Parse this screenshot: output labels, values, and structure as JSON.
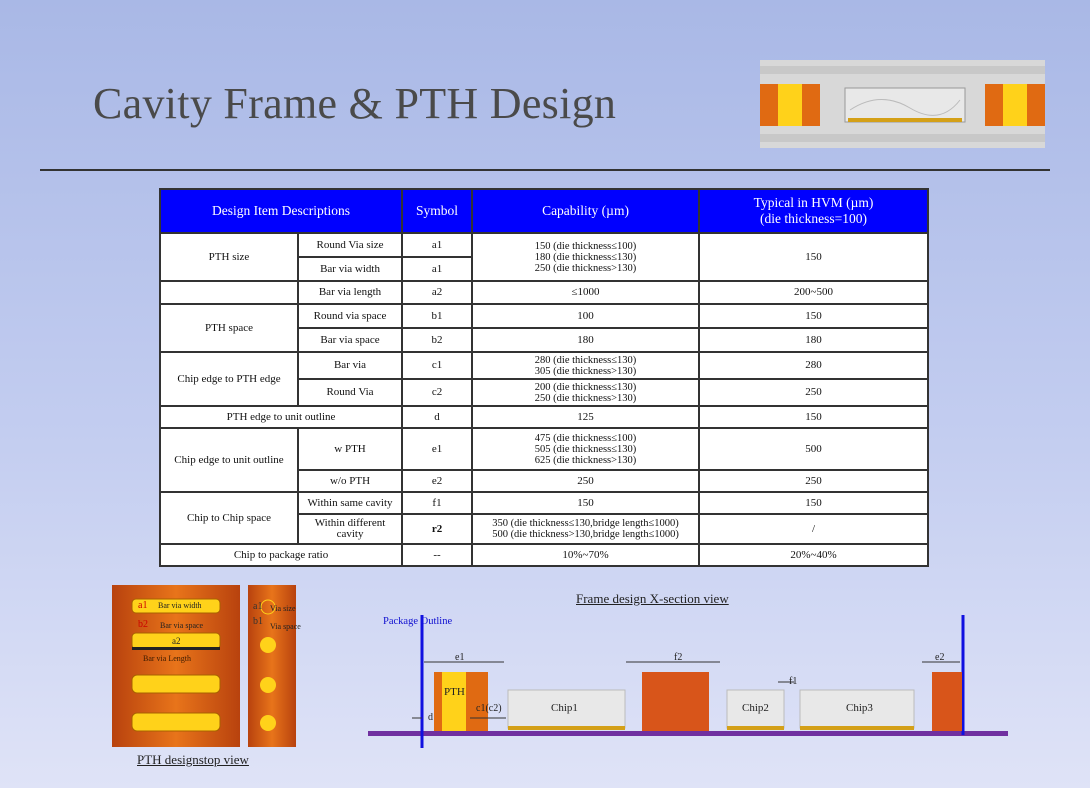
{
  "title": "Cavity Frame & PTH Design",
  "table": {
    "headers": [
      "Design Item Descriptions",
      "Symbol",
      "Capability (µm)",
      "Typical in HVM (µm)",
      "(die thickness=100)"
    ],
    "rows": {
      "pth_size": "PTH size",
      "round_via_size": "Round Via size",
      "a1_1": "a1",
      "cap_pth_1": "150 (die thickness≤100)",
      "cap_pth_2": "180 (die thickness≤130)",
      "cap_pth_3": "250 (die thickness>130)",
      "hvm_pth": "150",
      "bar_via_width": "Bar via width",
      "a1_2": "a1",
      "bar_via_length": "Bar via length",
      "a2": "a2",
      "cap_a2": "≤1000",
      "hvm_a2": "200~500",
      "pth_space": "PTH space",
      "round_via_space": "Round via space",
      "b1": "b1",
      "cap_b1": "100",
      "hvm_b1": "150",
      "bar_via_space": "Bar via space",
      "b2": "b2",
      "cap_b2": "180",
      "hvm_b2": "180",
      "chip_edge_pth": "Chip edge to PTH edge",
      "bar_via": "Bar via",
      "c1": "c1",
      "cap_c1_1": "280 (die thickness≤130)",
      "cap_c1_2": "305 (die thickness>130)",
      "hvm_c1": "280",
      "round_via": "Round Via",
      "c2": "c2",
      "cap_c2_1": "200 (die thickness≤130)",
      "cap_c2_2": "250 (die thickness>130)",
      "hvm_c2": "250",
      "pth_edge_unit": "PTH edge to unit outline",
      "d": "d",
      "cap_d": "125",
      "hvm_d": "150",
      "chip_edge_unit": "Chip edge to unit outline",
      "w_pth": "w PTH",
      "e1": "e1",
      "cap_e1_1": "475 (die thickness≤100)",
      "cap_e1_2": "505 (die thickness≤130)",
      "cap_e1_3": "625 (die thickness>130)",
      "hvm_e1": "500",
      "wo_pth": "w/o PTH",
      "e2": "e2",
      "cap_e2": "250",
      "hvm_e2": "250",
      "chip_chip": "Chip to Chip space",
      "within_same": "Within same cavity",
      "f1": "f1",
      "cap_f1": "150",
      "hvm_f1": "150",
      "within_diff": "Within different cavity",
      "r2": "r2",
      "cap_r2_1": "350 (die thickness≤130,bridge length≤1000)",
      "cap_r2_2": "500 (die thickness>130,bridge length≤1000)",
      "hvm_r2": "/",
      "chip_pkg": "Chip to package ratio",
      "dash": "--",
      "cap_ratio": "10%~70%",
      "hvm_ratio": "20%~40%"
    }
  },
  "top_view": {
    "a1": "a1",
    "bar_via_width": "Bar via width",
    "b2": "b2",
    "bar_via_space": "Bar via space",
    "a2": "a2",
    "bar_via_length": "Bar via Length",
    "a1r": "a1",
    "via_size": "Via size",
    "b1": "b1",
    "via_space": "Via space",
    "caption": "PTH designstop view"
  },
  "xsection": {
    "title": "Frame design X-section view",
    "package_outline": "Package Outline",
    "e1": "e1",
    "f2": "f2",
    "e2": "e2",
    "f1": "f1",
    "pth": "PTH",
    "d": "d",
    "c1c2": "c1(c2)",
    "chip1": "Chip1",
    "chip2": "Chip2",
    "chip3": "Chip3"
  },
  "colors": {
    "header": "#0000ff",
    "copper": "#e06a12",
    "gold": "#ffd21a",
    "purple": "#7030a0",
    "blue_line": "#1010e0"
  }
}
